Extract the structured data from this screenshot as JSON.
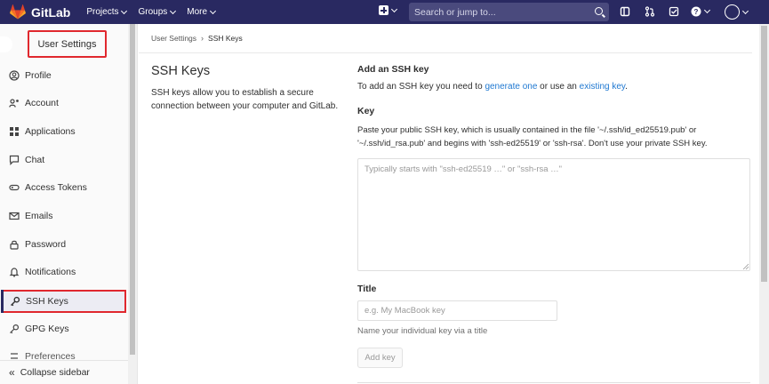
{
  "navbar": {
    "brand": "GitLab",
    "menu": [
      {
        "label": "Projects"
      },
      {
        "label": "Groups"
      },
      {
        "label": "More"
      }
    ],
    "search_placeholder": "Search or jump to..."
  },
  "sidebar": {
    "header": "User Settings",
    "items": [
      {
        "label": "Profile",
        "icon": "profile-icon"
      },
      {
        "label": "Account",
        "icon": "account-icon"
      },
      {
        "label": "Applications",
        "icon": "applications-icon"
      },
      {
        "label": "Chat",
        "icon": "chat-icon"
      },
      {
        "label": "Access Tokens",
        "icon": "access-tokens-icon"
      },
      {
        "label": "Emails",
        "icon": "emails-icon"
      },
      {
        "label": "Password",
        "icon": "lock-icon"
      },
      {
        "label": "Notifications",
        "icon": "bell-icon"
      },
      {
        "label": "SSH Keys",
        "icon": "key-icon",
        "active": true
      },
      {
        "label": "GPG Keys",
        "icon": "key-icon"
      },
      {
        "label": "Preferences",
        "icon": "preferences-icon"
      }
    ],
    "collapse_label": "Collapse sidebar"
  },
  "breadcrumb": {
    "parent": "User Settings",
    "current": "SSH Keys"
  },
  "page": {
    "title": "SSH Keys",
    "description": "SSH keys allow you to establish a secure connection between your computer and GitLab."
  },
  "form": {
    "heading": "Add an SSH key",
    "intro_before": "To add an SSH key you need to ",
    "link_generate": "generate one",
    "intro_middle": " or use an ",
    "link_existing": "existing key",
    "intro_after": ".",
    "key_label": "Key",
    "key_help": "Paste your public SSH key, which is usually contained in the file '~/.ssh/id_ed25519.pub' or '~/.ssh/id_rsa.pub' and begins with 'ssh-ed25519' or 'ssh-rsa'. Don't use your private SSH key.",
    "key_placeholder": "Typically starts with \"ssh-ed25519 …\" or \"ssh-rsa …\"",
    "key_value": "",
    "title_label": "Title",
    "title_placeholder": "e.g. My MacBook key",
    "title_value": "",
    "title_help": "Name your individual key via a title",
    "submit_label": "Add key"
  },
  "colors": {
    "navbar": "#292961",
    "link": "#1f78d1",
    "highlight": "#e0282e"
  }
}
